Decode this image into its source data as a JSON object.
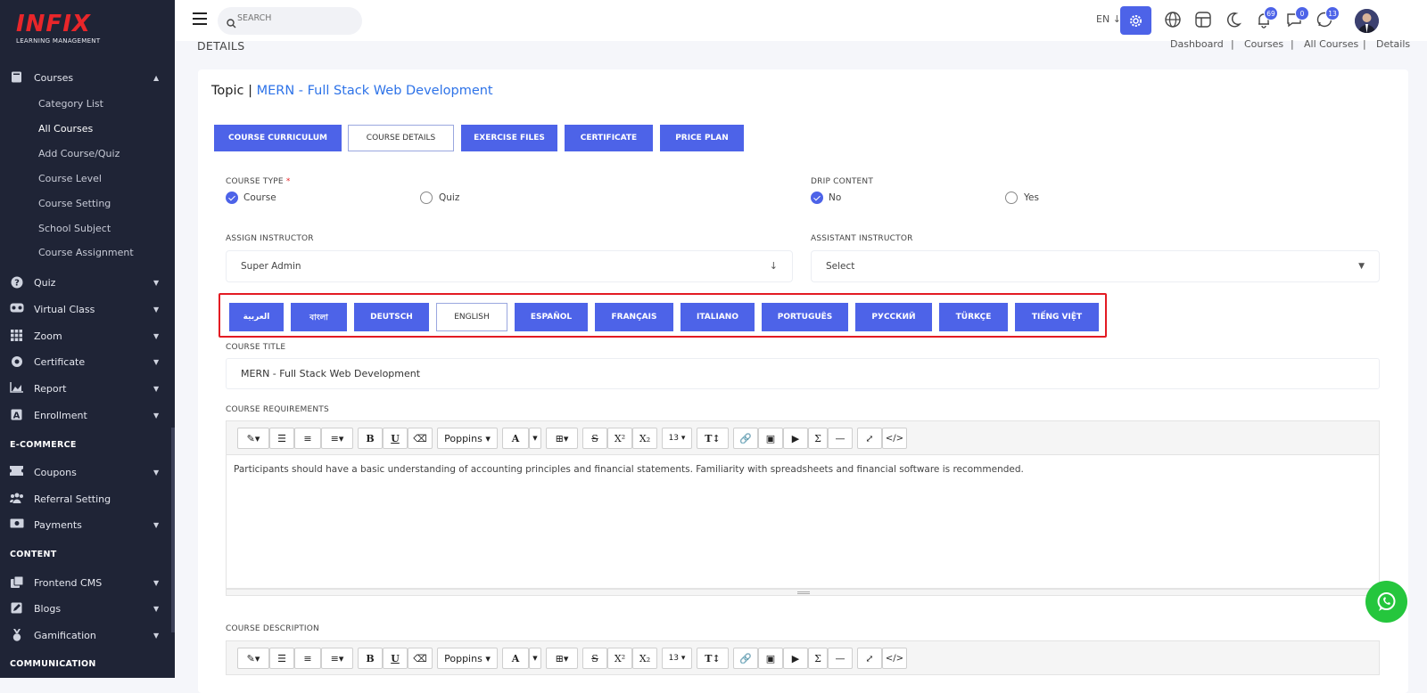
{
  "brand": {
    "name": "INFIX",
    "subtitle": "LEARNING MANAGEMENT"
  },
  "sidebar": {
    "courses_label": "Courses",
    "course_subitems": [
      "Category List",
      "All Courses",
      "Add Course/Quiz",
      "Course Level",
      "Course Setting",
      "School Subject",
      "Course Assignment"
    ],
    "items": [
      "Quiz",
      "Virtual Class",
      "Zoom",
      "Certificate",
      "Report",
      "Enrollment"
    ],
    "section_ecommerce": "E-COMMERCE",
    "ecommerce_items": [
      "Coupons",
      "Referral Setting",
      "Payments"
    ],
    "section_content": "CONTENT",
    "content_items": [
      "Frontend CMS",
      "Blogs",
      "Gamification"
    ],
    "section_communication": "COMMUNICATION"
  },
  "topbar": {
    "search_placeholder": "SEARCH",
    "language": "EN",
    "badges": {
      "notifications": "69",
      "messages": "0",
      "whatsapp": "13"
    }
  },
  "page": {
    "header": "DETAILS",
    "breadcrumb": [
      "Dashboard",
      "Courses",
      "All Courses",
      "Details"
    ],
    "topic_prefix": "Topic |",
    "topic_name": "MERN - Full Stack Web Development"
  },
  "tabs": [
    "COURSE CURRICULUM",
    "COURSE DETAILS",
    "EXERCISE FILES",
    "CERTIFICATE",
    "PRICE PLAN"
  ],
  "form": {
    "course_type_label": "COURSE TYPE",
    "required_mark": "*",
    "course_type_options": [
      "Course",
      "Quiz"
    ],
    "drip_label": "DRIP CONTENT",
    "drip_options": [
      "No",
      "Yes"
    ],
    "assign_instructor_label": "ASSIGN INSTRUCTOR",
    "assign_instructor_value": "Super Admin",
    "assistant_instructor_label": "ASSISTANT INSTRUCTOR",
    "assistant_instructor_value": "Select",
    "languages": [
      "العربية",
      "বাংলা",
      "DEUTSCH",
      "ENGLISH",
      "ESPAÑOL",
      "FRANÇAIS",
      "ITALIANO",
      "PORTUGUÊS",
      "РУССКИЙ",
      "TÜRKÇE",
      "TIẾNG VIỆT"
    ],
    "course_title_label": "COURSE TITLE",
    "course_title_value": "MERN - Full Stack Web Development",
    "requirements_label": "COURSE REQUIREMENTS",
    "requirements_text": "Participants should have a basic understanding of accounting principles and financial statements. Familiarity with spreadsheets and financial software is recommended.",
    "description_label": "COURSE DESCRIPTION"
  },
  "editor_toolbar": {
    "font": "Poppins",
    "size": "13",
    "sigma": "Σ"
  },
  "colors": {
    "primary": "#4d63e8",
    "sidebar": "#1f2436",
    "highlight": "#e31b23",
    "whatsapp": "#25c63d"
  }
}
